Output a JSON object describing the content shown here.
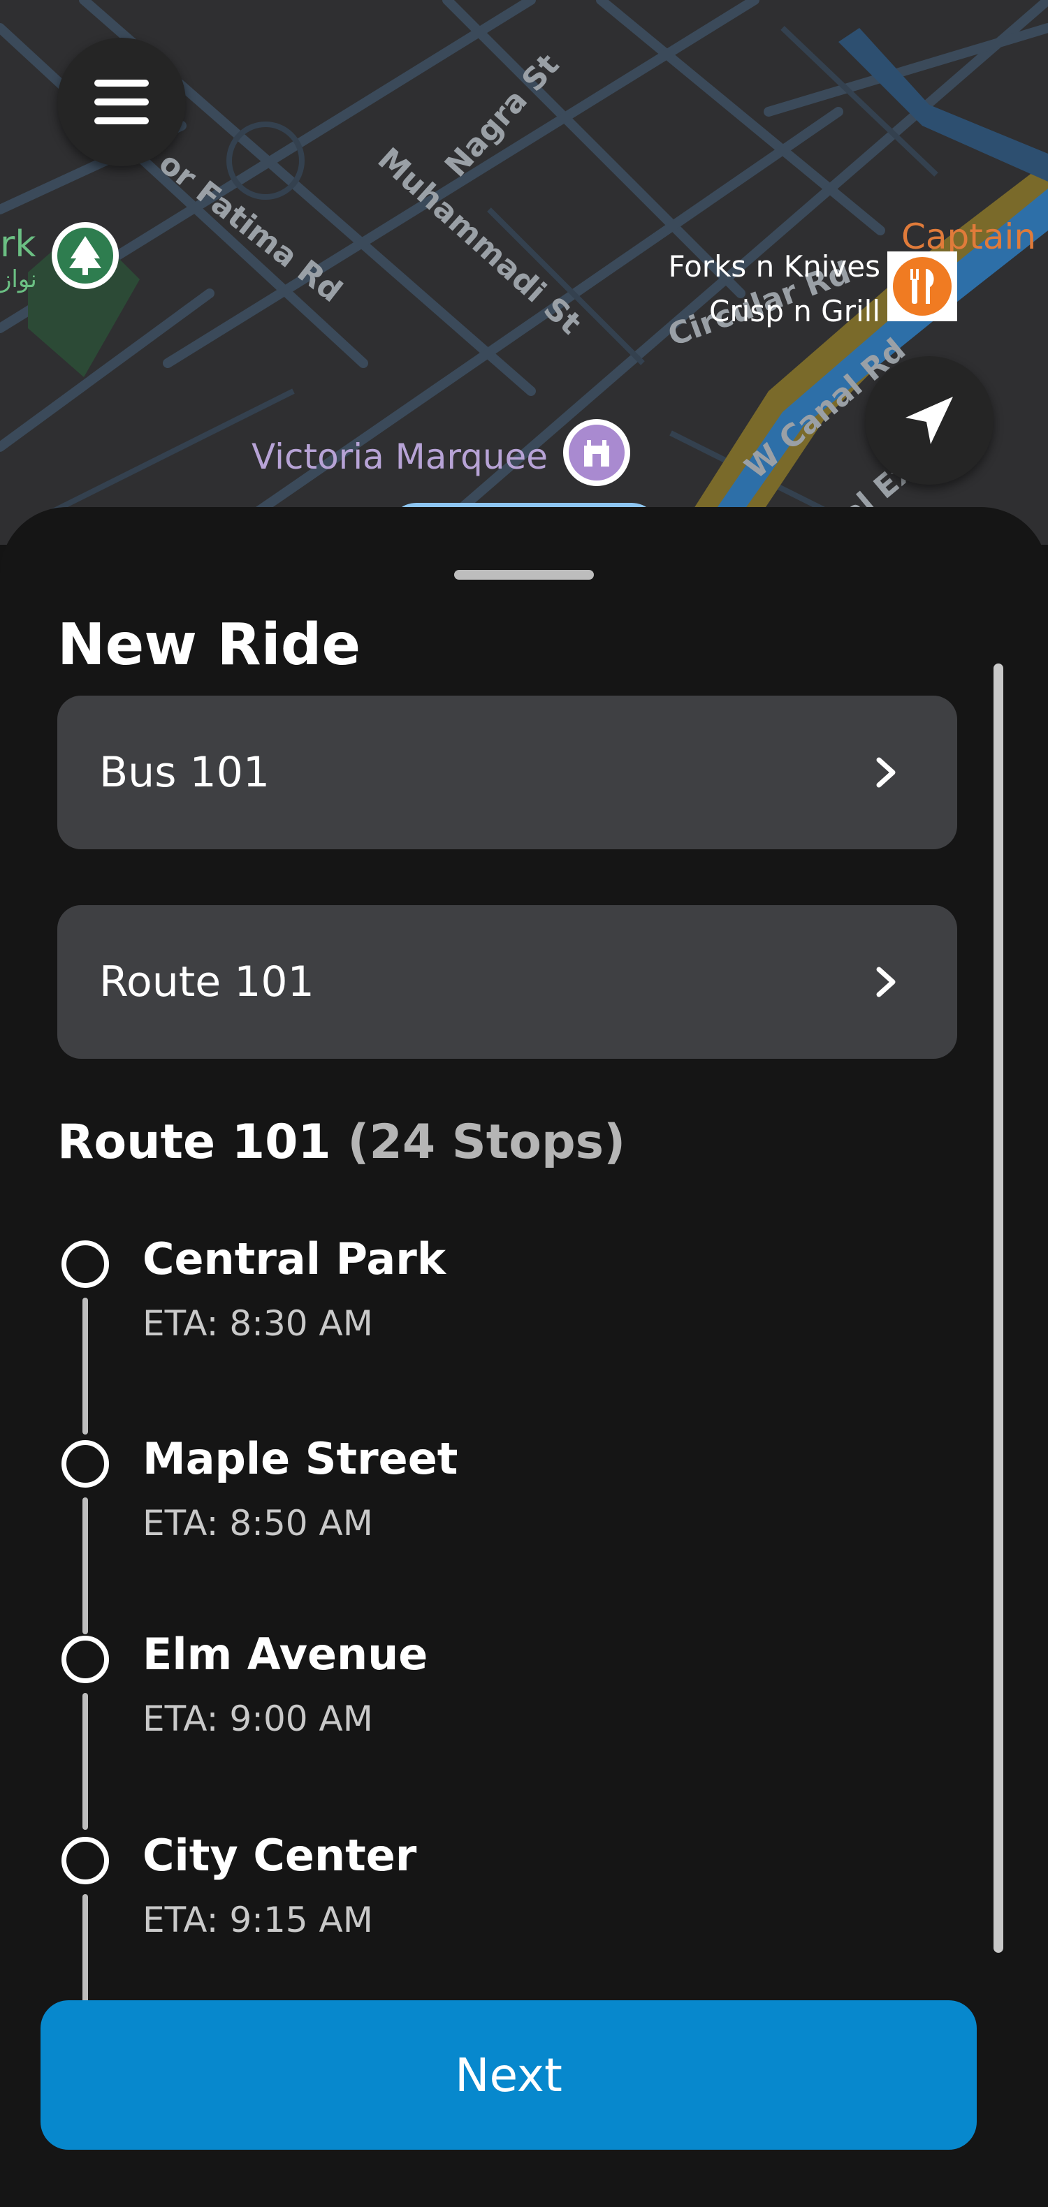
{
  "map": {
    "streets": [
      "Nagra St",
      "Muhammadi St",
      "or Fatima Rd",
      "Circular Rd",
      "W Canal Rd",
      "nal Ex"
    ],
    "pois": {
      "forks": "Forks n Knives",
      "crisp": "Crisp n Grill",
      "venue": "Victoria Marquee",
      "captain": "Captain",
      "park_partial": "rk",
      "park_urdu": "نواز"
    },
    "icons": {
      "menu": "hamburger-menu-icon",
      "locate": "navigation-arrow-icon",
      "park": "tree-icon",
      "venue": "landmark-icon",
      "restaurant": "fork-knife-icon"
    }
  },
  "sheet": {
    "title": "New Ride",
    "bus_select": "Bus 101",
    "route_select": "Route 101",
    "route_heading": "Route 101",
    "route_count": "(24 Stops)",
    "stops": [
      {
        "name": "Central Park",
        "eta": "ETA: 8:30 AM"
      },
      {
        "name": "Maple Street",
        "eta": "ETA: 8:50 AM"
      },
      {
        "name": "Elm Avenue",
        "eta": "ETA: 9:00 AM"
      },
      {
        "name": "City Center",
        "eta": "ETA: 9:15 AM"
      }
    ],
    "next_label": "Next"
  },
  "colors": {
    "accent": "#0788cd",
    "sheet_bg": "#151515",
    "field_bg": "#3f4043",
    "map_bg": "#2f2f31"
  }
}
